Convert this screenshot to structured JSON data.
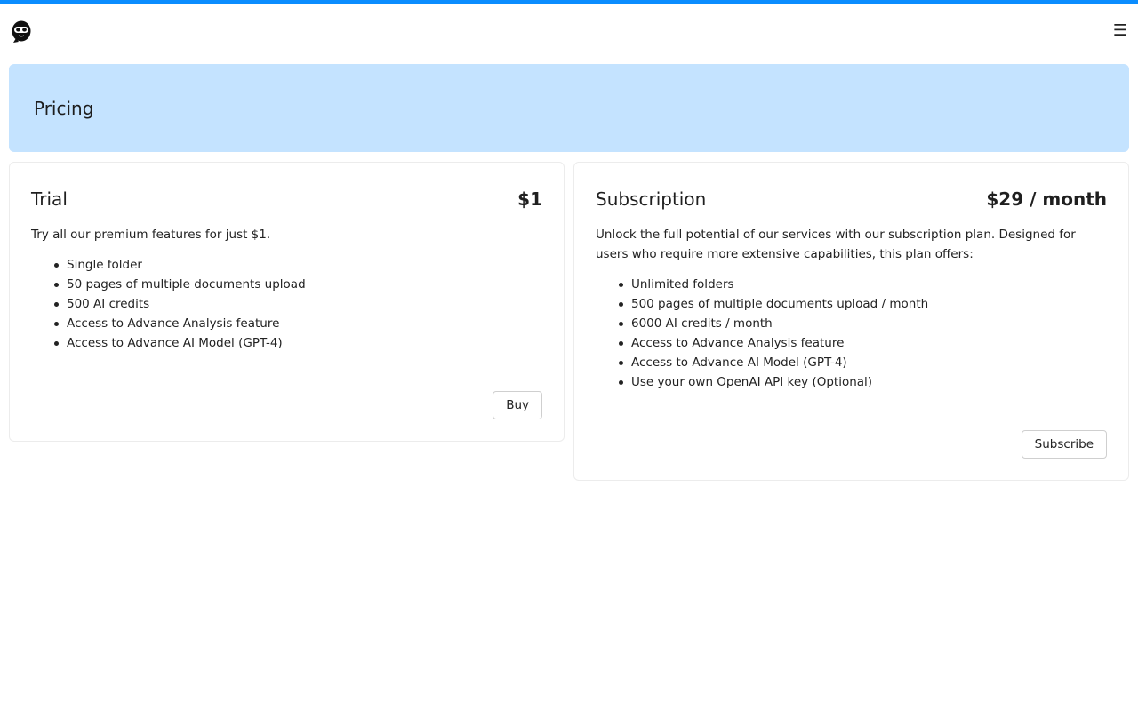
{
  "nav": {
    "logo_icon": "ninja-mask-icon",
    "menu_icon": "hamburger-menu-icon",
    "menu_glyph": "☰"
  },
  "header": {
    "title": "Pricing"
  },
  "plans": [
    {
      "name": "Trial",
      "price": "$1",
      "description": "Try all our premium features for just $1.",
      "features": [
        "Single folder",
        "50 pages of multiple documents upload",
        "500 AI credits",
        "Access to Advance Analysis feature",
        "Access to Advance AI Model (GPT-4)"
      ],
      "button_label": "Buy"
    },
    {
      "name": "Subscription",
      "price": "$29 / month",
      "description": "Unlock the full potential of our services with our subscription plan. Designed for users who require more extensive capabilities, this plan offers:",
      "features": [
        "Unlimited folders",
        "500 pages of multiple documents upload / month",
        "6000 AI credits / month",
        "Access to Advance Analysis feature",
        "Access to Advance AI Model (GPT-4)",
        "Use your own OpenAI API key (Optional)"
      ],
      "button_label": "Subscribe"
    }
  ],
  "colors": {
    "accent": "#0a8dff",
    "banner": "#c4e3ff"
  }
}
